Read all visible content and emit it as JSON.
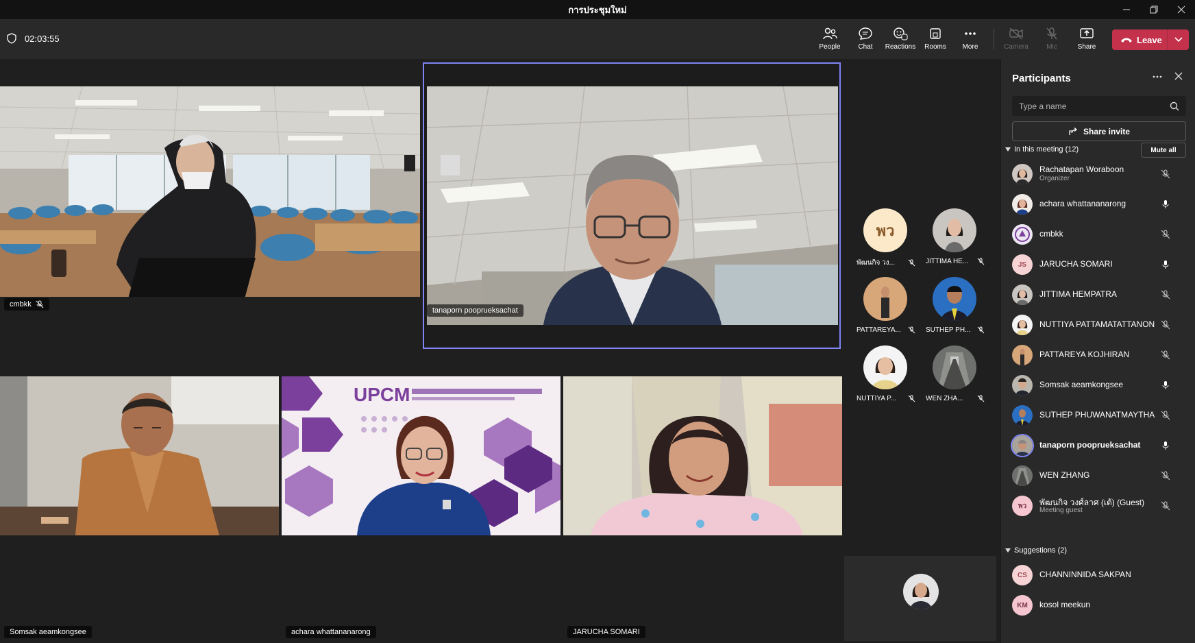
{
  "window": {
    "title": "การประชุมใหม่"
  },
  "toolbar": {
    "timer": "02:03:55",
    "buttons": {
      "people": "People",
      "chat": "Chat",
      "reactions": "Reactions",
      "rooms": "Rooms",
      "more": "More",
      "camera": "Camera",
      "mic": "Mic",
      "share": "Share"
    },
    "leave_label": "Leave",
    "leave_color": "#c4314b"
  },
  "stage": {
    "tiles": [
      {
        "name": "cmbkk",
        "muted": true
      },
      {
        "name": "tanaporn pooprueksachat",
        "speaking": true
      },
      {
        "name": "Somsak aeamkongsee"
      },
      {
        "name": "achara whattananarong"
      },
      {
        "name": "JARUCHA SOMARI"
      }
    ],
    "slide_logo": "UPCM",
    "mini": [
      {
        "name": "พัฒนกิจ วง...",
        "initials": "พว"
      },
      {
        "name": "JITTIMA HE..."
      },
      {
        "name": "PATTAREYA..."
      },
      {
        "name": "SUTHEP PH..."
      },
      {
        "name": "NUTTIYA P..."
      },
      {
        "name": "WEN ZHA..."
      }
    ]
  },
  "panel": {
    "title": "Participants",
    "search_placeholder": "Type a name",
    "share_invite": "Share invite",
    "in_meeting_label": "In this meeting (12)",
    "mute_all": "Mute all",
    "suggestions_label": "Suggestions (2)",
    "participants": [
      {
        "name": "Rachatapan Woraboon",
        "sub": "Organizer",
        "mic": "muted"
      },
      {
        "name": "achara whattananarong",
        "mic": "on"
      },
      {
        "name": "cmbkk",
        "mic": "muted"
      },
      {
        "name": "JARUCHA SOMARI",
        "initials": "JS",
        "mic": "on"
      },
      {
        "name": "JITTIMA HEMPATRA",
        "mic": "muted"
      },
      {
        "name": "NUTTIYA PATTAMATATTANON",
        "mic": "muted"
      },
      {
        "name": "PATTAREYA KOJHIRAN",
        "mic": "muted"
      },
      {
        "name": "Somsak aeamkongsee",
        "mic": "on"
      },
      {
        "name": "SUTHEP PHUWANATMAYTHA",
        "mic": "muted"
      },
      {
        "name": "tanaporn pooprueksachat",
        "mic": "on",
        "current": true
      },
      {
        "name": "WEN ZHANG",
        "mic": "muted"
      },
      {
        "name": "พัฒนกิจ วงศ์ลาศ (เต้) (Guest)",
        "sub": "Meeting guest",
        "initials": "พว",
        "mic": "muted"
      }
    ],
    "suggestions": [
      {
        "name": "CHANNINNIDA SAKPAN",
        "initials": "CS"
      },
      {
        "name": "kosol meekun",
        "initials": "KM"
      }
    ]
  }
}
